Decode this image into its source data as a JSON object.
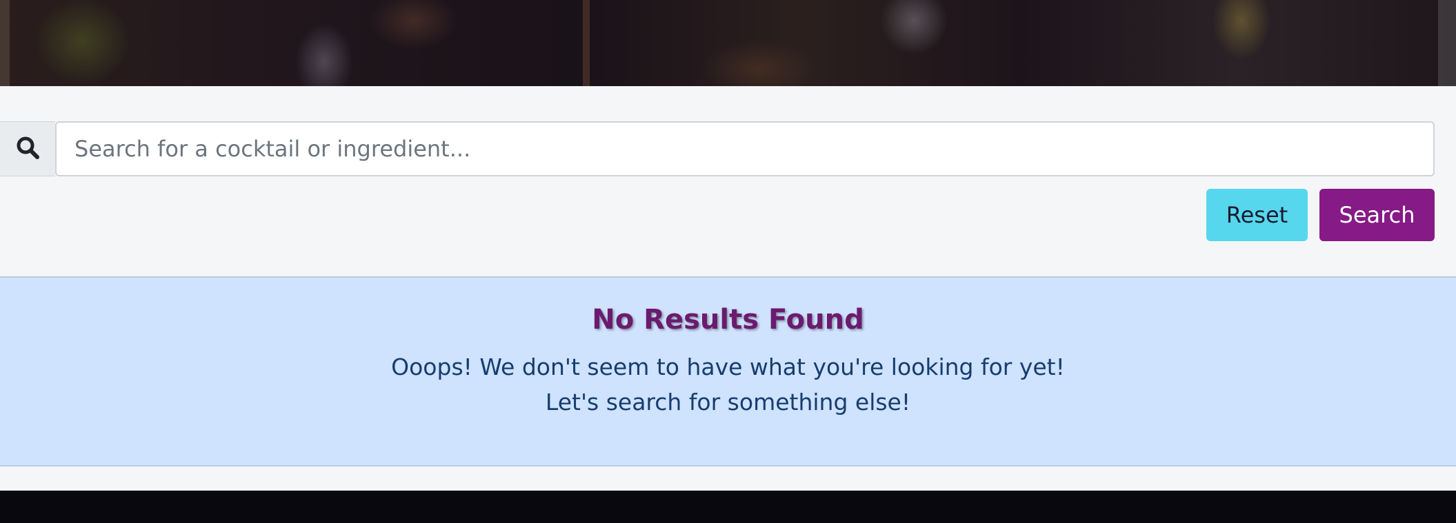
{
  "hero": {
    "image": "blurred bar interior photo"
  },
  "search": {
    "icon": "search-icon",
    "placeholder": "Search for a cocktail or ingredient...",
    "value": "",
    "reset_label": "Reset",
    "search_label": "Search"
  },
  "results": {
    "title": "No Results Found",
    "message_line1": "Ooops! We don't seem to have what you're looking for yet!",
    "message_line2": "Let's search for something else!"
  },
  "colors": {
    "reset_button": "#56d7ed",
    "search_button": "#861a86",
    "alert_background": "#cfe2fe",
    "title": "#6b1b6e",
    "message_text": "#163d6e",
    "footer": "#09080f"
  }
}
